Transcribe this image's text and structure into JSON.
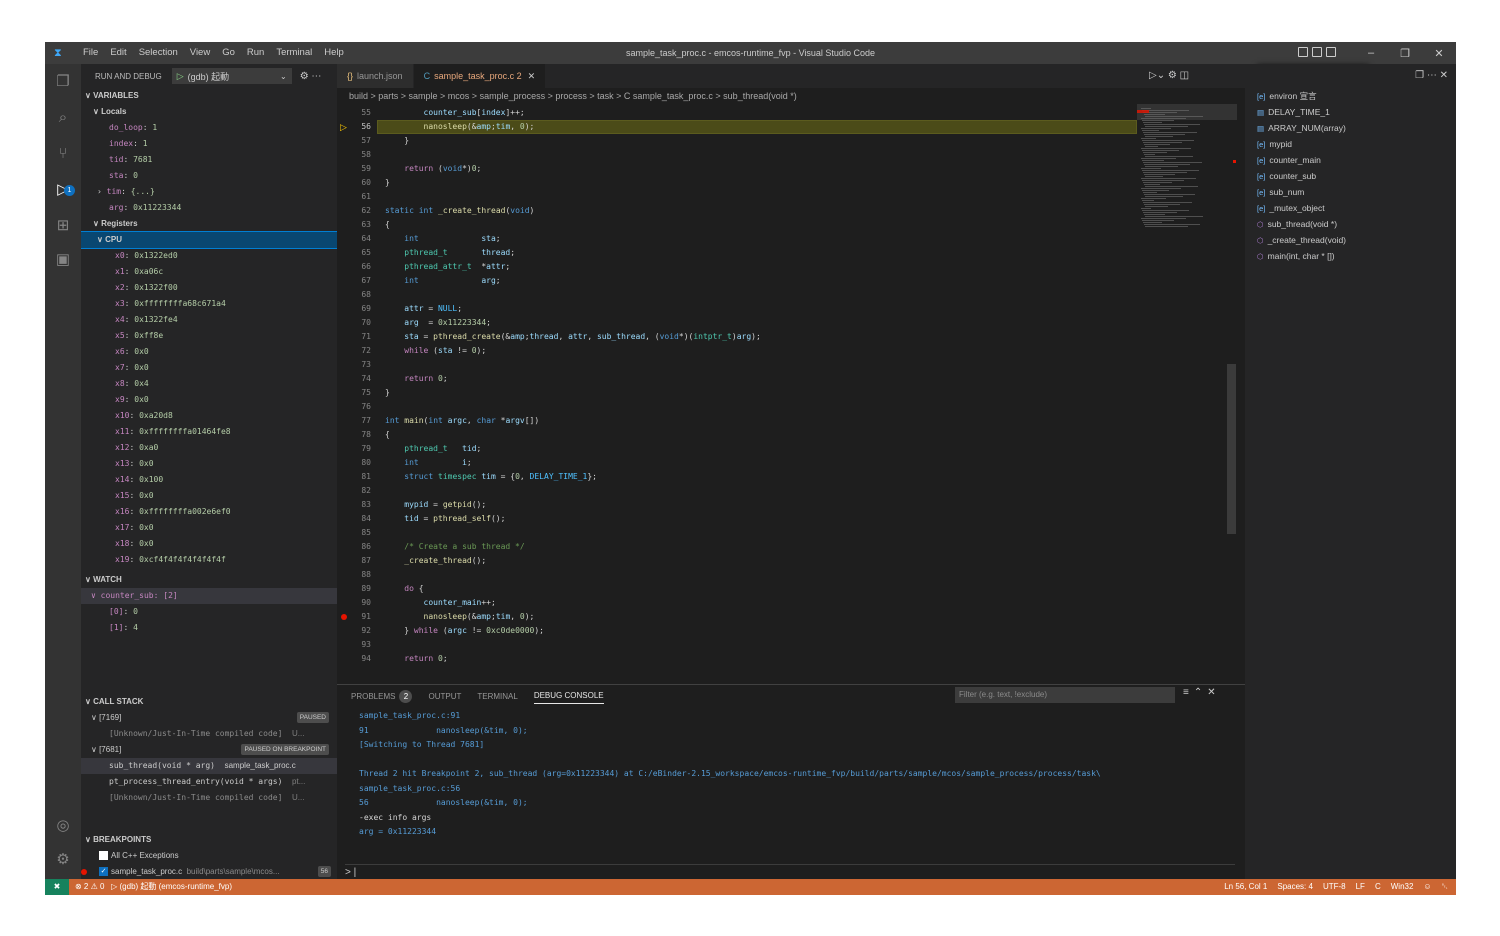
{
  "window": {
    "title": "sample_task_proc.c - emcos-runtime_fvp - Visual Studio Code"
  },
  "menu": [
    "File",
    "Edit",
    "Selection",
    "View",
    "Go",
    "Run",
    "Terminal",
    "Help"
  ],
  "sidebar": {
    "header": "RUN AND DEBUG",
    "config": "(gdb) 起動",
    "variables_title": "VARIABLES",
    "locals_title": "Locals",
    "locals": [
      {
        "name": "do_loop",
        "value": "1"
      },
      {
        "name": "index",
        "value": "1"
      },
      {
        "name": "tid",
        "value": "7681"
      },
      {
        "name": "sta",
        "value": "0"
      },
      {
        "name": "tim",
        "value": "{...}"
      },
      {
        "name": "arg",
        "value": "0x11223344"
      }
    ],
    "registers_title": "Registers",
    "cpu_title": "CPU",
    "registers": [
      {
        "name": "x0",
        "value": "0x1322ed0"
      },
      {
        "name": "x1",
        "value": "0xa06c"
      },
      {
        "name": "x2",
        "value": "0x1322f00"
      },
      {
        "name": "x3",
        "value": "0xffffffffa68c671a4"
      },
      {
        "name": "x4",
        "value": "0x1322fe4"
      },
      {
        "name": "x5",
        "value": "0xff8e"
      },
      {
        "name": "x6",
        "value": "0x0"
      },
      {
        "name": "x7",
        "value": "0x0"
      },
      {
        "name": "x8",
        "value": "0x4"
      },
      {
        "name": "x9",
        "value": "0x0"
      },
      {
        "name": "x10",
        "value": "0xa20d8"
      },
      {
        "name": "x11",
        "value": "0xffffffffa01464fe8"
      },
      {
        "name": "x12",
        "value": "0xa0"
      },
      {
        "name": "x13",
        "value": "0x0"
      },
      {
        "name": "x14",
        "value": "0x100"
      },
      {
        "name": "x15",
        "value": "0x0"
      },
      {
        "name": "x16",
        "value": "0xffffffffa002e6ef0"
      },
      {
        "name": "x17",
        "value": "0x0"
      },
      {
        "name": "x18",
        "value": "0x0"
      },
      {
        "name": "x19",
        "value": "0xcf4f4f4f4f4f4f4f"
      }
    ],
    "watch_title": "WATCH",
    "watch_expr": "counter_sub: [2]",
    "watch_items": [
      {
        "name": "[0]",
        "value": "0"
      },
      {
        "name": "[1]",
        "value": "4"
      }
    ],
    "callstack_title": "CALL STACK",
    "threads": [
      {
        "id": "[7169]",
        "status": "PAUSED",
        "frames": [
          {
            "fn": "[Unknown/Just-In-Time compiled code]",
            "file": "U..."
          }
        ]
      },
      {
        "id": "[7681]",
        "status": "PAUSED ON BREAKPOINT",
        "frames": [
          {
            "fn": "sub_thread(void * arg)",
            "file": "sample_task_proc.c"
          },
          {
            "fn": "pt_process_thread_entry(void * args)",
            "file": "pt..."
          },
          {
            "fn": "[Unknown/Just-In-Time compiled code]",
            "file": "U..."
          }
        ]
      }
    ],
    "breakpoints_title": "BREAKPOINTS",
    "breakpoints": [
      {
        "label": "All C++ Exceptions",
        "path": "",
        "line": ""
      },
      {
        "label": "sample_task_proc.c",
        "path": "build\\parts\\sample\\mcos...",
        "line": "56"
      },
      {
        "label": "sample_task_proc.c",
        "path": "build\\parts\\sample\\mcos...",
        "line": "91"
      }
    ]
  },
  "tabs": [
    {
      "label": "launch.json",
      "icon": "{}"
    },
    {
      "label": "sample_task_proc.c 2",
      "icon": "C"
    }
  ],
  "breadcrumb": "build > parts > sample > mcos > sample_process > process > task > C sample_task_proc.c > sub_thread(void *)",
  "code": {
    "lines": [
      {
        "n": "55",
        "t": "        counter_sub[index]++;"
      },
      {
        "n": "56",
        "t": "        nanosleep(&tim, 0);"
      },
      {
        "n": "57",
        "t": "    }"
      },
      {
        "n": "58",
        "t": ""
      },
      {
        "n": "59",
        "t": "    return (void*)0;"
      },
      {
        "n": "60",
        "t": "}"
      },
      {
        "n": "61",
        "t": ""
      },
      {
        "n": "62",
        "t": "static int _create_thread(void)"
      },
      {
        "n": "63",
        "t": "{"
      },
      {
        "n": "64",
        "t": "    int             sta;"
      },
      {
        "n": "65",
        "t": "    pthread_t       thread;"
      },
      {
        "n": "66",
        "t": "    pthread_attr_t  *attr;"
      },
      {
        "n": "67",
        "t": "    int             arg;"
      },
      {
        "n": "68",
        "t": ""
      },
      {
        "n": "69",
        "t": "    attr = NULL;"
      },
      {
        "n": "70",
        "t": "    arg  = 0x11223344;"
      },
      {
        "n": "71",
        "t": "    sta = pthread_create(&thread, attr, sub_thread, (void*)(intptr_t)arg);"
      },
      {
        "n": "72",
        "t": "    while (sta != 0);"
      },
      {
        "n": "73",
        "t": ""
      },
      {
        "n": "74",
        "t": "    return 0;"
      },
      {
        "n": "75",
        "t": "}"
      },
      {
        "n": "76",
        "t": ""
      },
      {
        "n": "77",
        "t": "int main(int argc, char *argv[])"
      },
      {
        "n": "78",
        "t": "{"
      },
      {
        "n": "79",
        "t": "    pthread_t   tid;"
      },
      {
        "n": "80",
        "t": "    int         i;"
      },
      {
        "n": "81",
        "t": "    struct timespec tim = {0, DELAY_TIME_1};"
      },
      {
        "n": "82",
        "t": ""
      },
      {
        "n": "83",
        "t": "    mypid = getpid();"
      },
      {
        "n": "84",
        "t": "    tid = pthread_self();"
      },
      {
        "n": "85",
        "t": ""
      },
      {
        "n": "86",
        "t": "    /* Create a sub thread */"
      },
      {
        "n": "87",
        "t": "    _create_thread();"
      },
      {
        "n": "88",
        "t": ""
      },
      {
        "n": "89",
        "t": "    do {"
      },
      {
        "n": "90",
        "t": "        counter_main++;"
      },
      {
        "n": "91",
        "t": "        nanosleep(&tim, 0);"
      },
      {
        "n": "92",
        "t": "    } while (argc != 0xc0de0000);"
      },
      {
        "n": "93",
        "t": ""
      },
      {
        "n": "94",
        "t": "    return 0;"
      }
    ]
  },
  "panel": {
    "tabs": [
      "PROBLEMS",
      "OUTPUT",
      "TERMINAL",
      "DEBUG CONSOLE"
    ],
    "problems_count": "2",
    "filter_placeholder": "Filter (e.g. text, !exclude)",
    "console": [
      "sample_task_proc.c:91",
      "91              nanosleep(&tim, 0);",
      "[Switching to Thread 7681]",
      "",
      "Thread 2 hit Breakpoint 2, sub_thread (arg=0x11223344) at C:/eBinder-2.15_workspace/emcos-runtime_fvp/build/parts/sample/mcos/sample_process/process/task\\",
      "sample_task_proc.c:56",
      "56              nanosleep(&tim, 0);",
      "-exec info args",
      "arg = 0x11223344"
    ],
    "prompt": ">"
  },
  "outline": [
    {
      "icon": "var",
      "label": "environ 宣言"
    },
    {
      "icon": "macro",
      "label": "DELAY_TIME_1"
    },
    {
      "icon": "macro",
      "label": "ARRAY_NUM(array)"
    },
    {
      "icon": "var",
      "label": "mypid"
    },
    {
      "icon": "var",
      "label": "counter_main"
    },
    {
      "icon": "var",
      "label": "counter_sub"
    },
    {
      "icon": "var",
      "label": "sub_num"
    },
    {
      "icon": "var",
      "label": "_mutex_object"
    },
    {
      "icon": "method",
      "label": "sub_thread(void *)"
    },
    {
      "icon": "method",
      "label": "_create_thread(void)"
    },
    {
      "icon": "method",
      "label": "main(int, char * [])"
    }
  ],
  "status": {
    "errors": "⊗ 2",
    "warnings": "⚠ 0",
    "debug": "(gdb) 起動 (emcos-runtime_fvp)",
    "position": "Ln 56, Col 1",
    "spaces": "Spaces: 4",
    "encoding": "UTF-8",
    "eol": "LF",
    "lang": "C",
    "platform": "Win32"
  },
  "colors": {
    "statusbar": "#cc6633",
    "highlight": "#4b4b18",
    "breakpoint": "#e51400"
  }
}
